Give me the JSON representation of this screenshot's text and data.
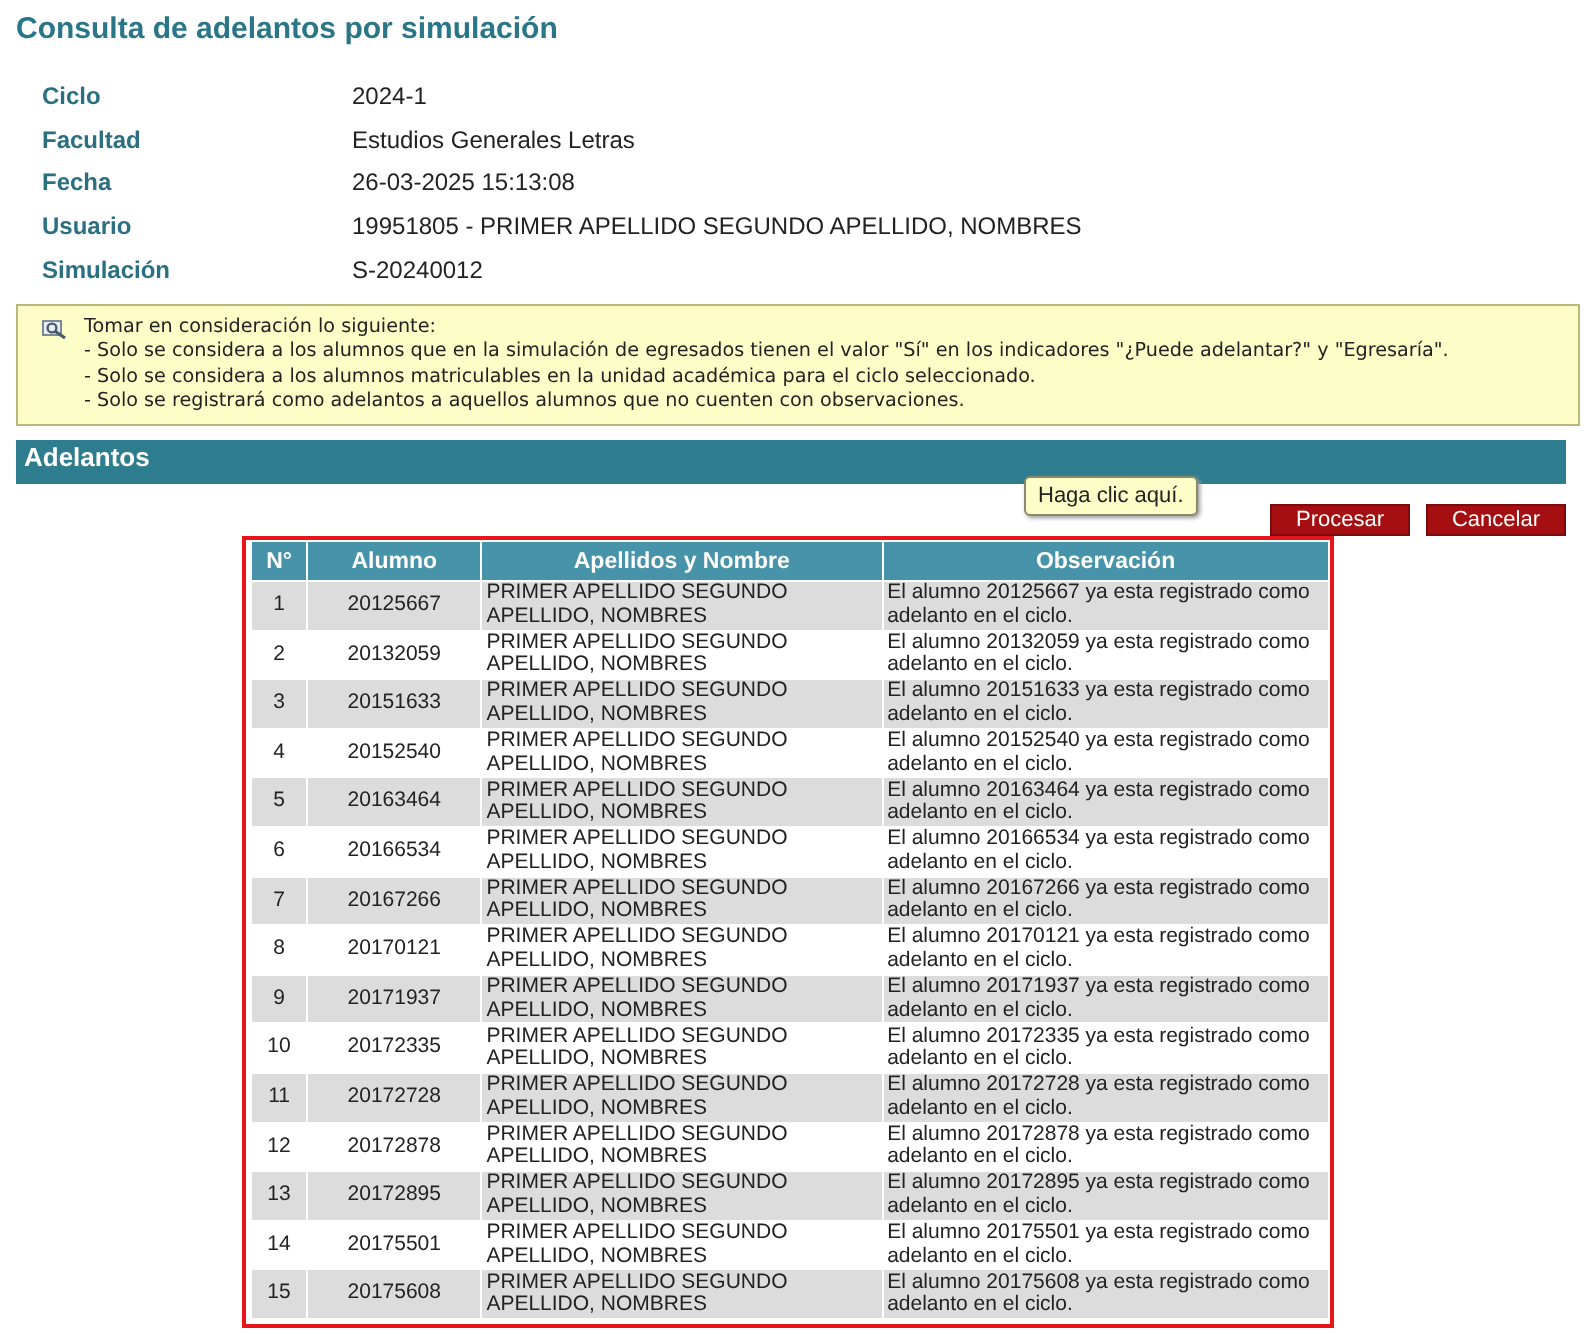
{
  "title": "Consulta de adelantos por simulación",
  "info": [
    {
      "label": "Ciclo",
      "value": "2024-1"
    },
    {
      "label": "Facultad",
      "value": "Estudios Generales Letras"
    },
    {
      "label": "Fecha",
      "value": "26-03-2025 15:13:08"
    },
    {
      "label": "Usuario",
      "value": "19951805 - PRIMER APELLIDO SEGUNDO APELLIDO, NOMBRES"
    },
    {
      "label": "Simulación",
      "value": "S-20240012"
    }
  ],
  "note": {
    "heading": "Tomar en consideración lo siguiente:",
    "lines": [
      "- Solo se considera a los alumnos que en la simulación de egresados tienen el valor \"Sí\" en los indicadores \"¿Puede adelantar?\" y \"Egresaría\".",
      "- Solo se considera a los alumnos matriculables en la unidad académica para el ciclo seleccionado.",
      "- Solo se registrará como adelantos a aquellos alumnos que no cuenten con observaciones."
    ]
  },
  "section": {
    "title": "Adelantos"
  },
  "tooltip": "Haga clic aquí.",
  "buttons": [
    "Procesar",
    "Cancelar"
  ],
  "table": {
    "columns": [
      "N°",
      "Alumno",
      "Apellidos y Nombre",
      "Observación"
    ],
    "rows": [
      [
        "1",
        "20125667",
        "PRIMER APELLIDO SEGUNDO APELLIDO, NOMBRES",
        "El alumno 20125667 ya esta registrado como adelanto en el ciclo."
      ],
      [
        "2",
        "20132059",
        "PRIMER APELLIDO SEGUNDO APELLIDO, NOMBRES",
        "El alumno 20132059 ya esta registrado como adelanto en el ciclo."
      ],
      [
        "3",
        "20151633",
        "PRIMER APELLIDO SEGUNDO APELLIDO, NOMBRES",
        "El alumno 20151633 ya esta registrado como adelanto en el ciclo."
      ],
      [
        "4",
        "20152540",
        "PRIMER APELLIDO SEGUNDO APELLIDO, NOMBRES",
        "El alumno 20152540 ya esta registrado como adelanto en el ciclo."
      ],
      [
        "5",
        "20163464",
        "PRIMER APELLIDO SEGUNDO APELLIDO, NOMBRES",
        "El alumno 20163464 ya esta registrado como adelanto en el ciclo."
      ],
      [
        "6",
        "20166534",
        "PRIMER APELLIDO SEGUNDO APELLIDO, NOMBRES",
        "El alumno 20166534 ya esta registrado como adelanto en el ciclo."
      ],
      [
        "7",
        "20167266",
        "PRIMER APELLIDO SEGUNDO APELLIDO, NOMBRES",
        "El alumno 20167266 ya esta registrado como adelanto en el ciclo."
      ],
      [
        "8",
        "20170121",
        "PRIMER APELLIDO SEGUNDO APELLIDO, NOMBRES",
        "El alumno 20170121 ya esta registrado como adelanto en el ciclo."
      ],
      [
        "9",
        "20171937",
        "PRIMER APELLIDO SEGUNDO APELLIDO, NOMBRES",
        "El alumno 20171937 ya esta registrado como adelanto en el ciclo."
      ],
      [
        "10",
        "20172335",
        "PRIMER APELLIDO SEGUNDO APELLIDO, NOMBRES",
        "El alumno 20172335 ya esta registrado como adelanto en el ciclo."
      ],
      [
        "11",
        "20172728",
        "PRIMER APELLIDO SEGUNDO APELLIDO, NOMBRES",
        "El alumno 20172728 ya esta registrado como adelanto en el ciclo."
      ],
      [
        "12",
        "20172878",
        "PRIMER APELLIDO SEGUNDO APELLIDO, NOMBRES",
        "El alumno 20172878 ya esta registrado como adelanto en el ciclo."
      ],
      [
        "13",
        "20172895",
        "PRIMER APELLIDO SEGUNDO APELLIDO, NOMBRES",
        "El alumno 20172895 ya esta registrado como adelanto en el ciclo."
      ],
      [
        "14",
        "20175501",
        "PRIMER APELLIDO SEGUNDO APELLIDO, NOMBRES",
        "El alumno 20175501 ya esta registrado como adelanto en el ciclo."
      ],
      [
        "15",
        "20175608",
        "PRIMER APELLIDO SEGUNDO APELLIDO, NOMBRES",
        "El alumno 20175608 ya esta registrado como adelanto en el ciclo."
      ]
    ]
  }
}
